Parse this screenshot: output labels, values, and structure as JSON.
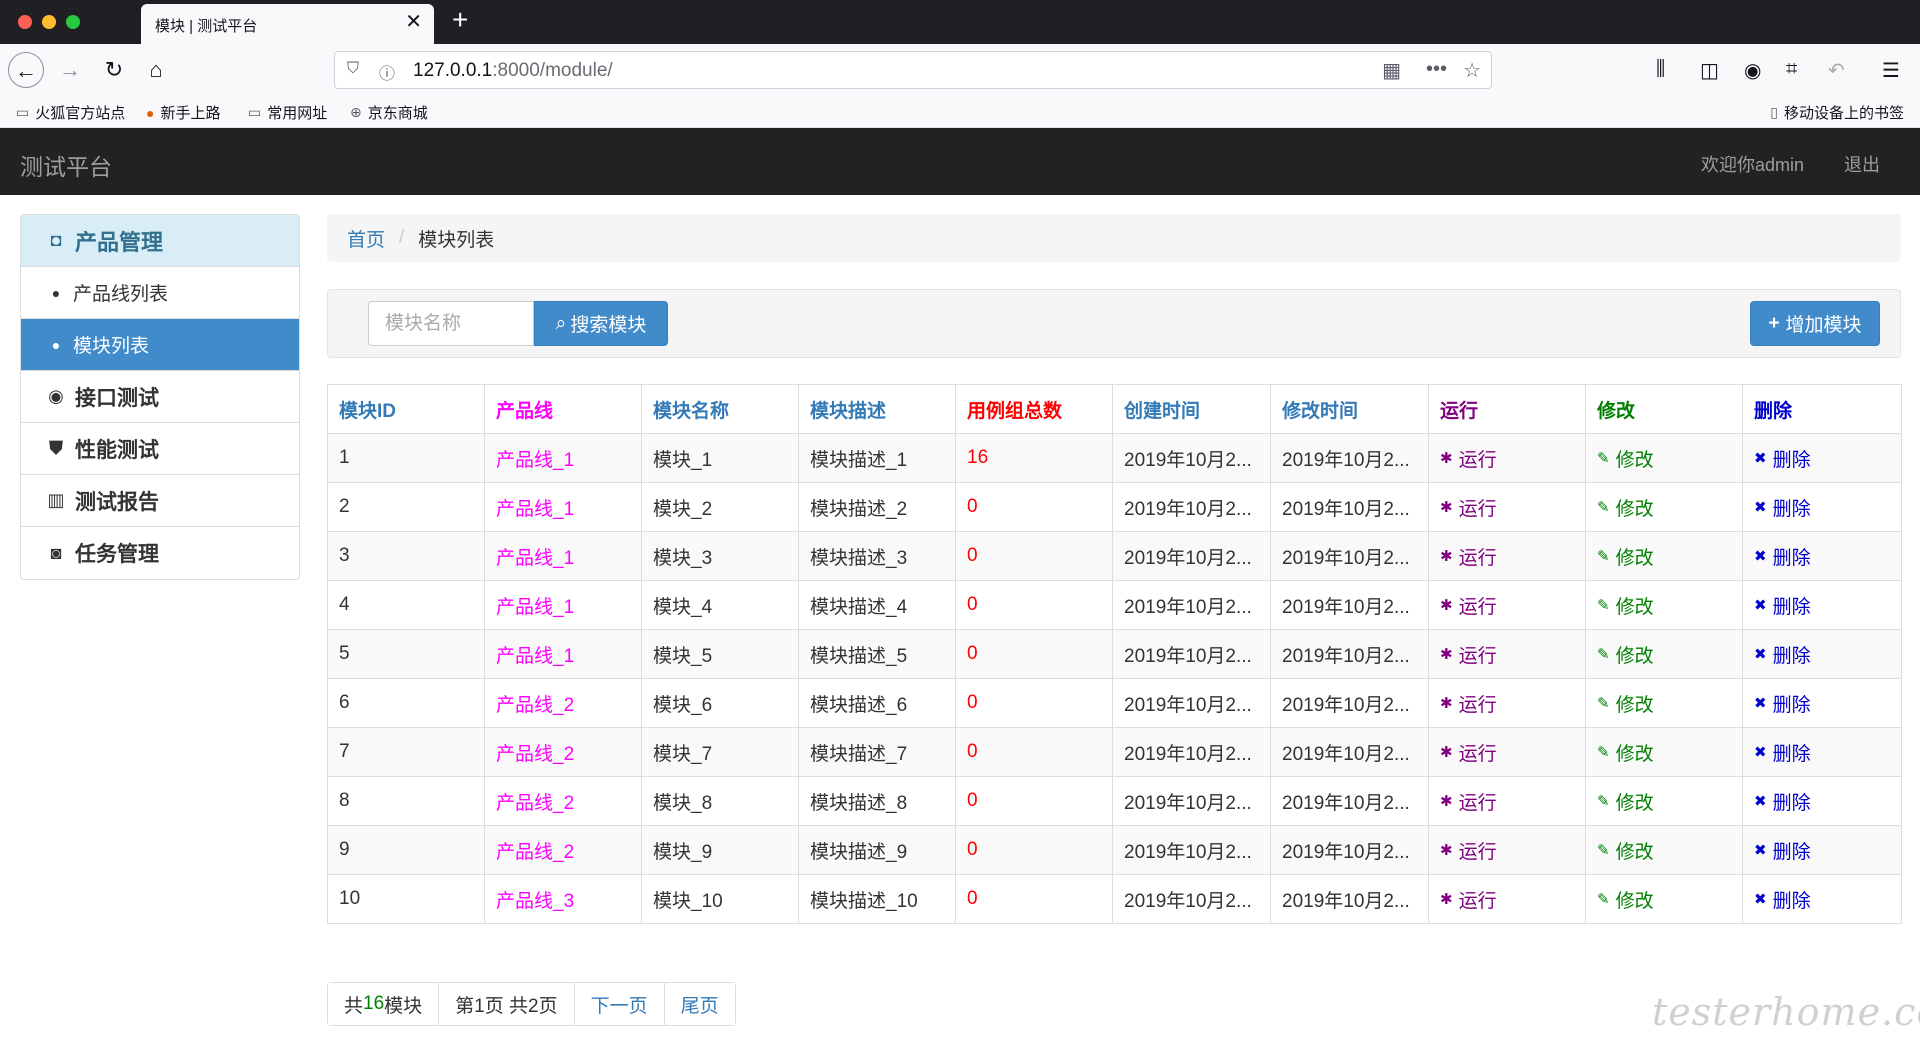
{
  "browser": {
    "tab_title": "模块 | 测试平台",
    "url_host": "127.0.0.1",
    "url_rest": ":8000/module/",
    "bookmarks": [
      "火狐官方站点",
      "新手上路",
      "常用网址",
      "京东商城"
    ],
    "mobile_bookmarks": "移动设备上的书签"
  },
  "app": {
    "brand": "测试平台",
    "welcome": "欢迎你admin",
    "logout": "退出"
  },
  "sidebar": {
    "header": "产品管理",
    "items": [
      {
        "label": "产品线列表",
        "icon": "apple-icon"
      },
      {
        "label": "模块列表",
        "icon": "android-icon"
      },
      {
        "label": "接口测试",
        "icon": "github-icon"
      },
      {
        "label": "性能测试",
        "icon": "html5-icon"
      },
      {
        "label": "测试报告",
        "icon": "bar-chart-icon"
      },
      {
        "label": "任务管理",
        "icon": "octocat-icon"
      }
    ]
  },
  "breadcrumb": {
    "home": "首页",
    "current": "模块列表"
  },
  "search": {
    "placeholder": "模块名称",
    "button": "搜索模块",
    "add_button": "增加模块"
  },
  "table": {
    "headers": [
      "模块ID",
      "产品线",
      "模块名称",
      "模块描述",
      "用例组总数",
      "创建时间",
      "修改时间",
      "运行",
      "修改",
      "删除"
    ],
    "rows": [
      {
        "id": "1",
        "product": "产品线_1",
        "name": "模块_1",
        "desc": "模块描述_1",
        "count": "16",
        "created": "2019年10月2...",
        "modified": "2019年10月2..."
      },
      {
        "id": "2",
        "product": "产品线_1",
        "name": "模块_2",
        "desc": "模块描述_2",
        "count": "0",
        "created": "2019年10月2...",
        "modified": "2019年10月2..."
      },
      {
        "id": "3",
        "product": "产品线_1",
        "name": "模块_3",
        "desc": "模块描述_3",
        "count": "0",
        "created": "2019年10月2...",
        "modified": "2019年10月2..."
      },
      {
        "id": "4",
        "product": "产品线_1",
        "name": "模块_4",
        "desc": "模块描述_4",
        "count": "0",
        "created": "2019年10月2...",
        "modified": "2019年10月2..."
      },
      {
        "id": "5",
        "product": "产品线_1",
        "name": "模块_5",
        "desc": "模块描述_5",
        "count": "0",
        "created": "2019年10月2...",
        "modified": "2019年10月2..."
      },
      {
        "id": "6",
        "product": "产品线_2",
        "name": "模块_6",
        "desc": "模块描述_6",
        "count": "0",
        "created": "2019年10月2...",
        "modified": "2019年10月2..."
      },
      {
        "id": "7",
        "product": "产品线_2",
        "name": "模块_7",
        "desc": "模块描述_7",
        "count": "0",
        "created": "2019年10月2...",
        "modified": "2019年10月2..."
      },
      {
        "id": "8",
        "product": "产品线_2",
        "name": "模块_8",
        "desc": "模块描述_8",
        "count": "0",
        "created": "2019年10月2...",
        "modified": "2019年10月2..."
      },
      {
        "id": "9",
        "product": "产品线_2",
        "name": "模块_9",
        "desc": "模块描述_9",
        "count": "0",
        "created": "2019年10月2...",
        "modified": "2019年10月2..."
      },
      {
        "id": "10",
        "product": "产品线_3",
        "name": "模块_10",
        "desc": "模块描述_10",
        "count": "0",
        "created": "2019年10月2...",
        "modified": "2019年10月2..."
      }
    ],
    "actions": {
      "run": "运行",
      "edit": "修改",
      "delete": "删除"
    }
  },
  "pagination": {
    "total_prefix": "共",
    "total_count": "16",
    "total_suffix": "模块",
    "page_info": "第1页 共2页",
    "next": "下一页",
    "last": "尾页"
  },
  "watermark": "testerhome.com"
}
